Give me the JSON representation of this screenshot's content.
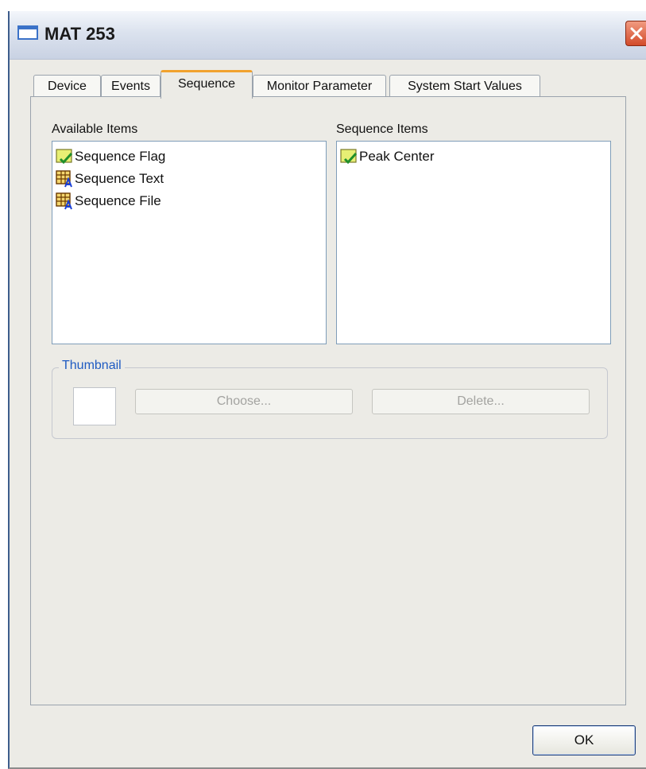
{
  "window": {
    "title": "MAT 253"
  },
  "tabs": [
    {
      "label": "Device"
    },
    {
      "label": "Events"
    },
    {
      "label": "Sequence",
      "active": true
    },
    {
      "label": "Monitor Parameter"
    },
    {
      "label": "System Start Values"
    }
  ],
  "available": {
    "label": "Available Items",
    "items": [
      {
        "label": "Sequence Flag",
        "icon": "flag-check-icon"
      },
      {
        "label": "Sequence Text",
        "icon": "table-text-icon"
      },
      {
        "label": "Sequence File",
        "icon": "table-text-icon"
      }
    ]
  },
  "sequence": {
    "label": "Sequence Items",
    "items": [
      {
        "label": "Peak Center",
        "icon": "flag-check-icon"
      }
    ]
  },
  "thumbnail": {
    "legend": "Thumbnail",
    "choose_label": "Choose...",
    "delete_label": "Delete..."
  },
  "footer": {
    "ok_label": "OK"
  },
  "colors": {
    "accent_tab": "#f1a22e",
    "groupbox_legend": "#1f5bc2",
    "close_button": "#d24b2a"
  }
}
